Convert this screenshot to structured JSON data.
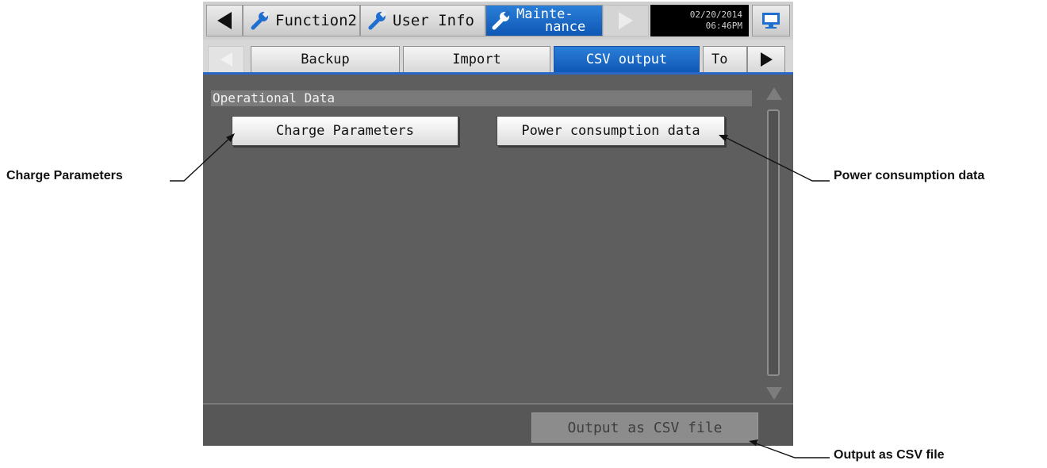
{
  "topnav": {
    "back_icon": "left-arrow-icon",
    "function2_label": "Function2",
    "userinfo_label": "User Info",
    "maintenance_line1": "Mainte-",
    "maintenance_line2": "nance",
    "forward_icon": "right-arrow-icon",
    "date": "02/20/2014",
    "time": "06:46PM",
    "monitor_icon": "monitor-icon"
  },
  "subtabs": {
    "backup": "Backup",
    "import": "Import",
    "csv_output": "CSV output",
    "to": "To"
  },
  "content": {
    "section_title": "Operational Data",
    "charge_button": "Charge Parameters",
    "power_button": "Power consumption data"
  },
  "footer": {
    "output_button": "Output as CSV file"
  },
  "callouts": {
    "charge": "Charge Parameters",
    "power": "Power consumption data",
    "output": "Output as CSV file"
  },
  "colors": {
    "active_tab": "#1a6cc9",
    "panel_bg": "#5e5e5e",
    "clock_bg": "#000000"
  }
}
